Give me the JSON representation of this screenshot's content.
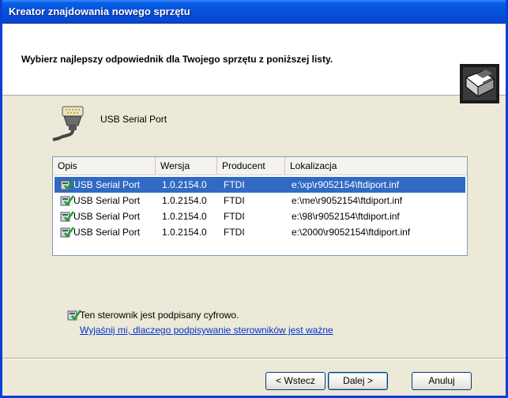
{
  "window": {
    "title": "Kreator znajdowania nowego sprzętu"
  },
  "header": {
    "instruction": "Wybierz najlepszy odpowiednik dla Twojego sprzętu z poniższej listy."
  },
  "device": {
    "name": "USB Serial Port"
  },
  "driver_list": {
    "columns": [
      "Opis",
      "Wersja",
      "Producent",
      "Lokalizacja"
    ],
    "rows": [
      {
        "opis": "USB Serial Port",
        "wersja": "1.0.2154.0",
        "producent": "FTDI",
        "lokalizacja": "e:\\xp\\r9052154\\ftdiport.inf",
        "selected": true
      },
      {
        "opis": "USB Serial Port",
        "wersja": "1.0.2154.0",
        "producent": "FTDI",
        "lokalizacja": "e:\\me\\r9052154\\ftdiport.inf",
        "selected": false
      },
      {
        "opis": "USB Serial Port",
        "wersja": "1.0.2154.0",
        "producent": "FTDI",
        "lokalizacja": "e:\\98\\r9052154\\ftdiport.inf",
        "selected": false
      },
      {
        "opis": "USB Serial Port",
        "wersja": "1.0.2154.0",
        "producent": "FTDI",
        "lokalizacja": "e:\\2000\\r9052154\\ftdiport.inf",
        "selected": false
      }
    ]
  },
  "signature": {
    "text": "Ten sterownik jest podpisany cyfrowo.",
    "link": "Wyjaśnij mi, dlaczego podpisywanie sterowników jest ważne"
  },
  "buttons": {
    "back": "< Wstecz",
    "next": "Dalej >",
    "cancel": "Anuluj"
  },
  "colors": {
    "titlebar": "#0550dc",
    "selection": "#316ac5",
    "dialog_bg": "#ece9d8",
    "link": "#0033cc"
  },
  "icons": {
    "header": "hardware-wizard-icon",
    "device": "serial-port-icon",
    "driver": "signed-driver-icon"
  }
}
